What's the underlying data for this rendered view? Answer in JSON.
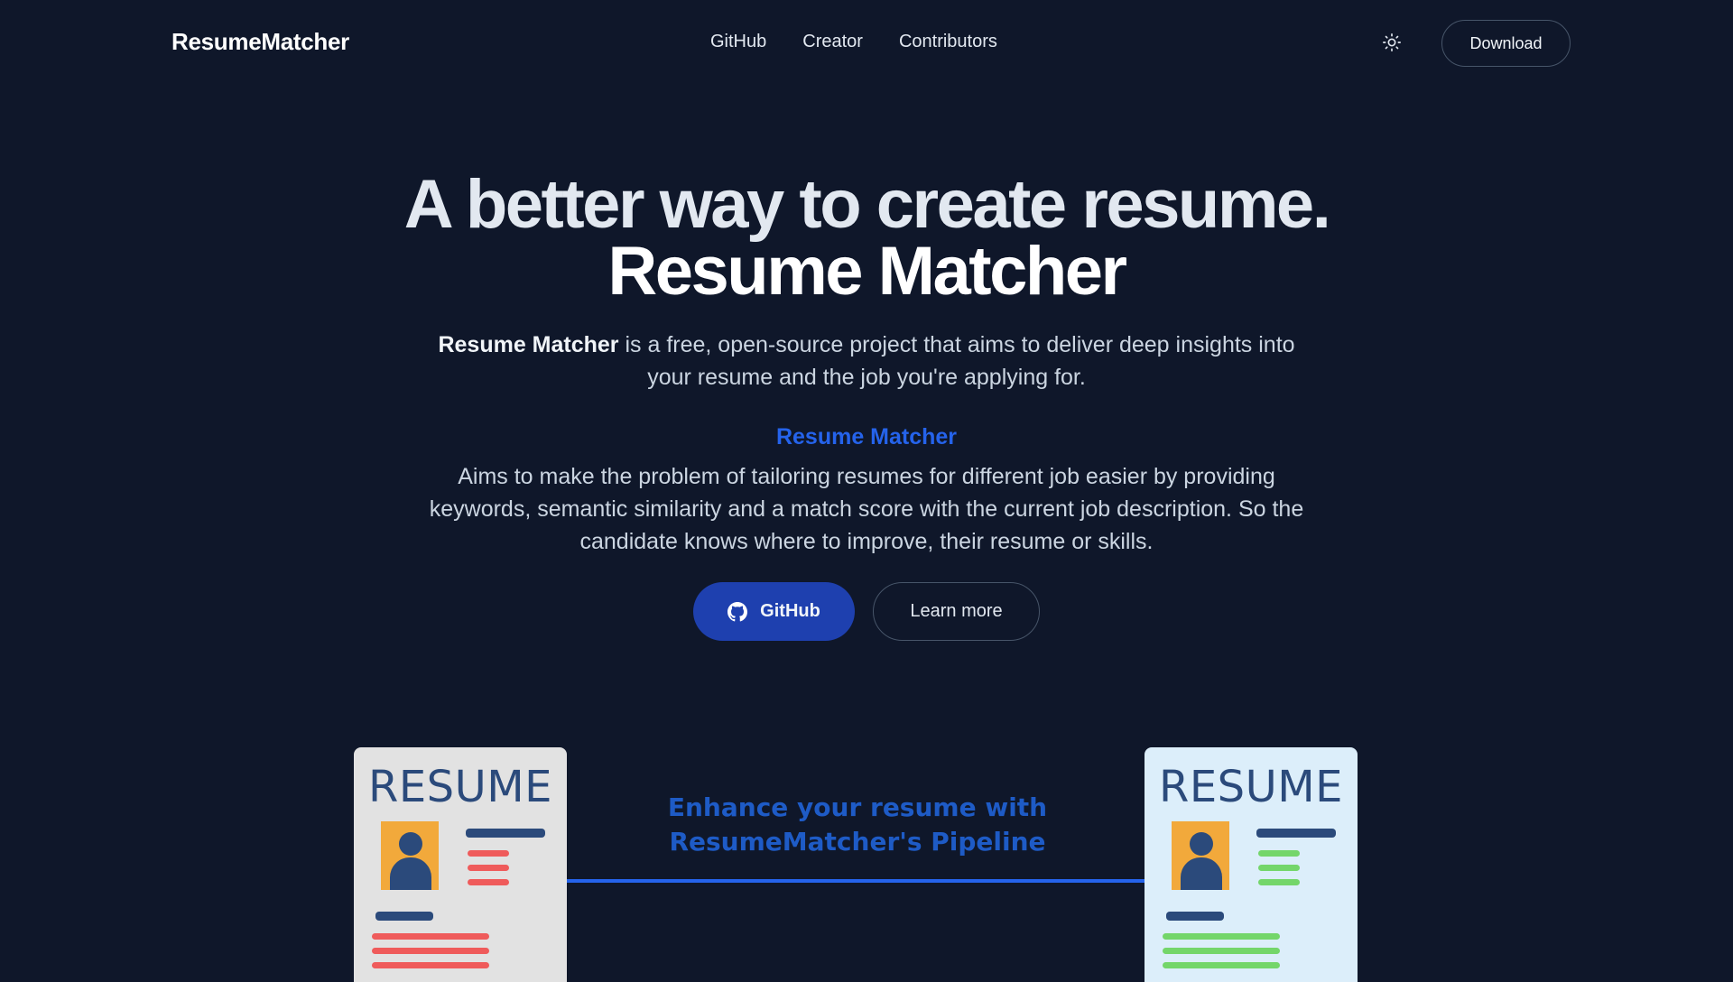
{
  "header": {
    "brand": "ResumeMatcher",
    "nav": [
      "GitHub",
      "Creator",
      "Contributors"
    ],
    "theme_icon": "sun-icon",
    "download_label": "Download"
  },
  "hero": {
    "title_line1": "A better way to create resume.",
    "title_line2": "Resume Matcher",
    "intro_strong": "Resume Matcher",
    "intro_rest": " is a free, open-source project that aims to deliver deep insights into your resume and the job you're applying for.",
    "subheading": "Resume Matcher",
    "aims_text": "Aims to make the problem of tailoring resumes for different job easier by providing keywords, semantic similarity and a match score with the current job description. So the candidate knows where to improve, their resume or skills.",
    "github_button": "GitHub",
    "github_icon": "github-icon",
    "learn_more_button": "Learn more"
  },
  "illustration": {
    "left_card_title": "RESUME",
    "right_card_title": "RESUME",
    "caption_line1": "Enhance your resume with",
    "caption_line2": "ResumeMatcher's Pipeline"
  },
  "colors": {
    "background": "#0f172a",
    "accent_blue": "#2563eb",
    "button_blue": "#1e40af"
  }
}
